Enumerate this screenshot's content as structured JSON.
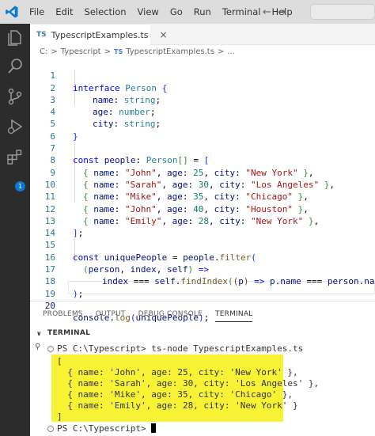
{
  "menu": [
    "File",
    "Edit",
    "Selection",
    "View",
    "Go",
    "Run",
    "Terminal",
    "Help"
  ],
  "nav": {
    "back": "←",
    "forward": "→"
  },
  "tab": {
    "badge": "TS",
    "label": "TypescriptExamples.ts",
    "close": "×"
  },
  "breadcrumb": {
    "root": "C:",
    "sep": ">",
    "folder": "Typescript",
    "badge": "TS",
    "file": "TypescriptExamples.ts",
    "more": "..."
  },
  "extensions_badge": "1",
  "line_numbers": [
    "1",
    "2",
    "3",
    "4",
    "5",
    "6",
    "7",
    "8",
    "9",
    "10",
    "11",
    "12",
    "13",
    "14",
    "15",
    "16",
    "17",
    "18",
    "19",
    "20"
  ],
  "current_line": "20",
  "code": {
    "l1": [
      "interface",
      " ",
      "Person",
      " ",
      "{"
    ],
    "l2": [
      "name",
      ": ",
      "string",
      ";"
    ],
    "l3": [
      "age",
      ": ",
      "number",
      ";"
    ],
    "l4": [
      "city",
      ": ",
      "string",
      ";"
    ],
    "l5": [
      "}"
    ],
    "l7": [
      "const",
      " ",
      "people",
      ": ",
      "Person",
      "[]",
      " = ",
      "["
    ],
    "rows": [
      {
        "name": "\"John\"",
        "age": "25",
        "city": "\"New York\"",
        "end": ","
      },
      {
        "name": "\"Sarah\"",
        "age": "30",
        "city": "\"Los Angeles\"",
        "end": ","
      },
      {
        "name": "\"Mike\"",
        "age": "35",
        "city": "\"Chicago\"",
        "end": ","
      },
      {
        "name": "\"John\"",
        "age": "40",
        "city": "\"Houston\"",
        "end": ","
      },
      {
        "name": "\"Emily\"",
        "age": "28",
        "city": "\"New York\"",
        "end": ","
      }
    ],
    "row_keys": {
      "open": "{",
      "name": "name",
      "age": "age",
      "city": "city",
      "close": "}",
      "colon": ": ",
      "comma": ", "
    },
    "l13": [
      "]",
      ";"
    ],
    "l15": [
      "const",
      " ",
      "uniquePeople",
      " = ",
      "people",
      ".",
      "filter",
      "("
    ],
    "l16": [
      "(",
      "person",
      ", ",
      "index",
      ", ",
      "self",
      ")",
      " =>"
    ],
    "l17": [
      "index",
      " === ",
      "self",
      ".",
      "findIndex",
      "(",
      "(",
      "p",
      ")",
      " => ",
      "p",
      ".",
      "name",
      " === ",
      "person",
      ".",
      "name",
      ")"
    ],
    "l18": [
      ")",
      ";"
    ],
    "l20": [
      "console",
      ".",
      "log",
      "(",
      "uniquePeople",
      ")",
      ";"
    ]
  },
  "panel_tabs": [
    "PROBLEMS",
    "OUTPUT",
    "DEBUG CONSOLE",
    "TERMINAL"
  ],
  "terminal": {
    "header": "TERMINAL",
    "caret": "∨",
    "side_icon": "⚲",
    "command": "PS C:\\Typescript> ts-node TypescriptExamples.ts",
    "output": [
      "[",
      "  { name: 'John', age: 25, city: 'New York' },",
      "  { name: 'Sarah', age: 30, city: 'Los Angeles' },",
      "  { name: 'Mike', age: 35, city: 'Chicago' },",
      "  { name: 'Emily', age: 28, city: 'New York' }",
      "]"
    ],
    "prompt": "PS C:\\Typescript> "
  }
}
